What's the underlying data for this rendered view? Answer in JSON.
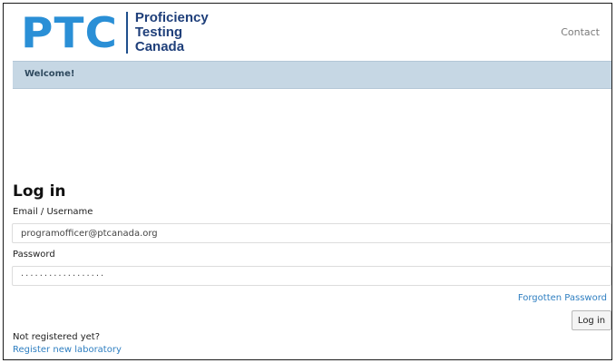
{
  "header": {
    "logo": {
      "mark": "PTC",
      "line1": "Proficiency",
      "line2": "Testing",
      "line3": "Canada"
    },
    "contact_label": "Contact"
  },
  "welcome": {
    "text": "Welcome!"
  },
  "login": {
    "title": "Log in",
    "email_label": "Email / Username",
    "email_value": "programofficer@ptcanada.org",
    "password_label": "Password",
    "password_value": "··················",
    "forgot_label": "Forgotten Password",
    "submit_label": "Log in"
  },
  "register": {
    "prompt": "Not registered yet?",
    "link_label": "Register new laboratory"
  },
  "colors": {
    "brand_blue": "#2a8fd6",
    "brand_navy": "#1f3f7a",
    "welcome_bar": "#c6d7e4",
    "link": "#2f7fc1"
  }
}
